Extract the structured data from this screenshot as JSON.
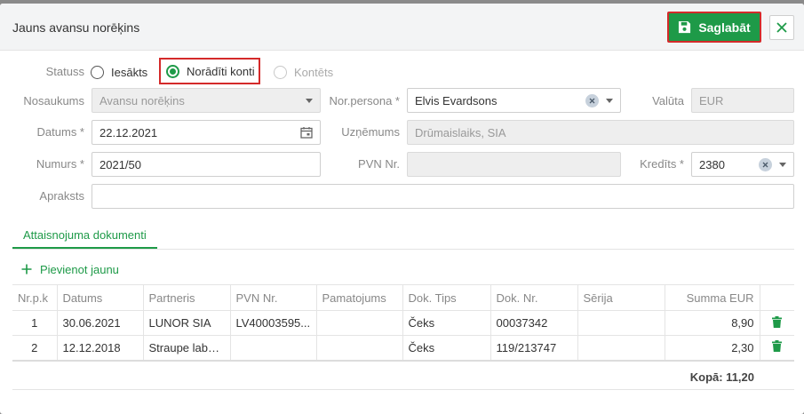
{
  "dialog": {
    "title": "Jauns avansu norēķins",
    "save_label": "Saglabāt"
  },
  "status": {
    "label": "Statuss",
    "options": [
      {
        "label": "Iesākts",
        "checked": false,
        "disabled": false
      },
      {
        "label": "Norādīti konti",
        "checked": true,
        "disabled": false
      },
      {
        "label": "Kontēts",
        "checked": false,
        "disabled": true
      }
    ]
  },
  "form": {
    "nosaukums_label": "Nosaukums",
    "nosaukums_value": "Avansu norēķins",
    "datums_label": "Datums *",
    "datums_value": "22.12.2021",
    "numurs_label": "Numurs *",
    "numurs_value": "2021/50",
    "apraksts_label": "Apraksts",
    "apraksts_value": "",
    "norpersona_label": "Nor.persona *",
    "norpersona_value": "Elvis Evardsons",
    "uznemums_label": "Uzņēmums",
    "uznemums_value": "Drūmaislaiks, SIA",
    "pvn_label": "PVN Nr.",
    "pvn_value": "",
    "valuta_label": "Valūta",
    "valuta_value": "EUR",
    "kredits_label": "Kredīts *",
    "kredits_value": "2380"
  },
  "tabs": {
    "active": "Attaisnojuma dokumenti"
  },
  "add_new_label": "Pievienot jaunu",
  "table": {
    "headers": [
      "Nr.p.k",
      "Datums",
      "Partneris",
      "PVN Nr.",
      "Pamatojums",
      "Dok. Tips",
      "Dok. Nr.",
      "Sērija",
      "Summa EUR",
      ""
    ],
    "rows": [
      {
        "nr": "1",
        "datums": "30.06.2021",
        "partneris": "LUNOR SIA",
        "pvn": "LV40003595...",
        "pamatojums": "",
        "tips": "Čeks",
        "doknr": "00037342",
        "serija": "",
        "summa": "8,90"
      },
      {
        "nr": "2",
        "datums": "12.12.2018",
        "partneris": "Straupe labot...",
        "pvn": "",
        "pamatojums": "",
        "tips": "Čeks",
        "doknr": "119/213747",
        "serija": "",
        "summa": "2,30"
      }
    ],
    "total": "Kopā: 11,20"
  },
  "colors": {
    "primary": "#1e9a48",
    "highlight_border": "#d42a2a"
  }
}
